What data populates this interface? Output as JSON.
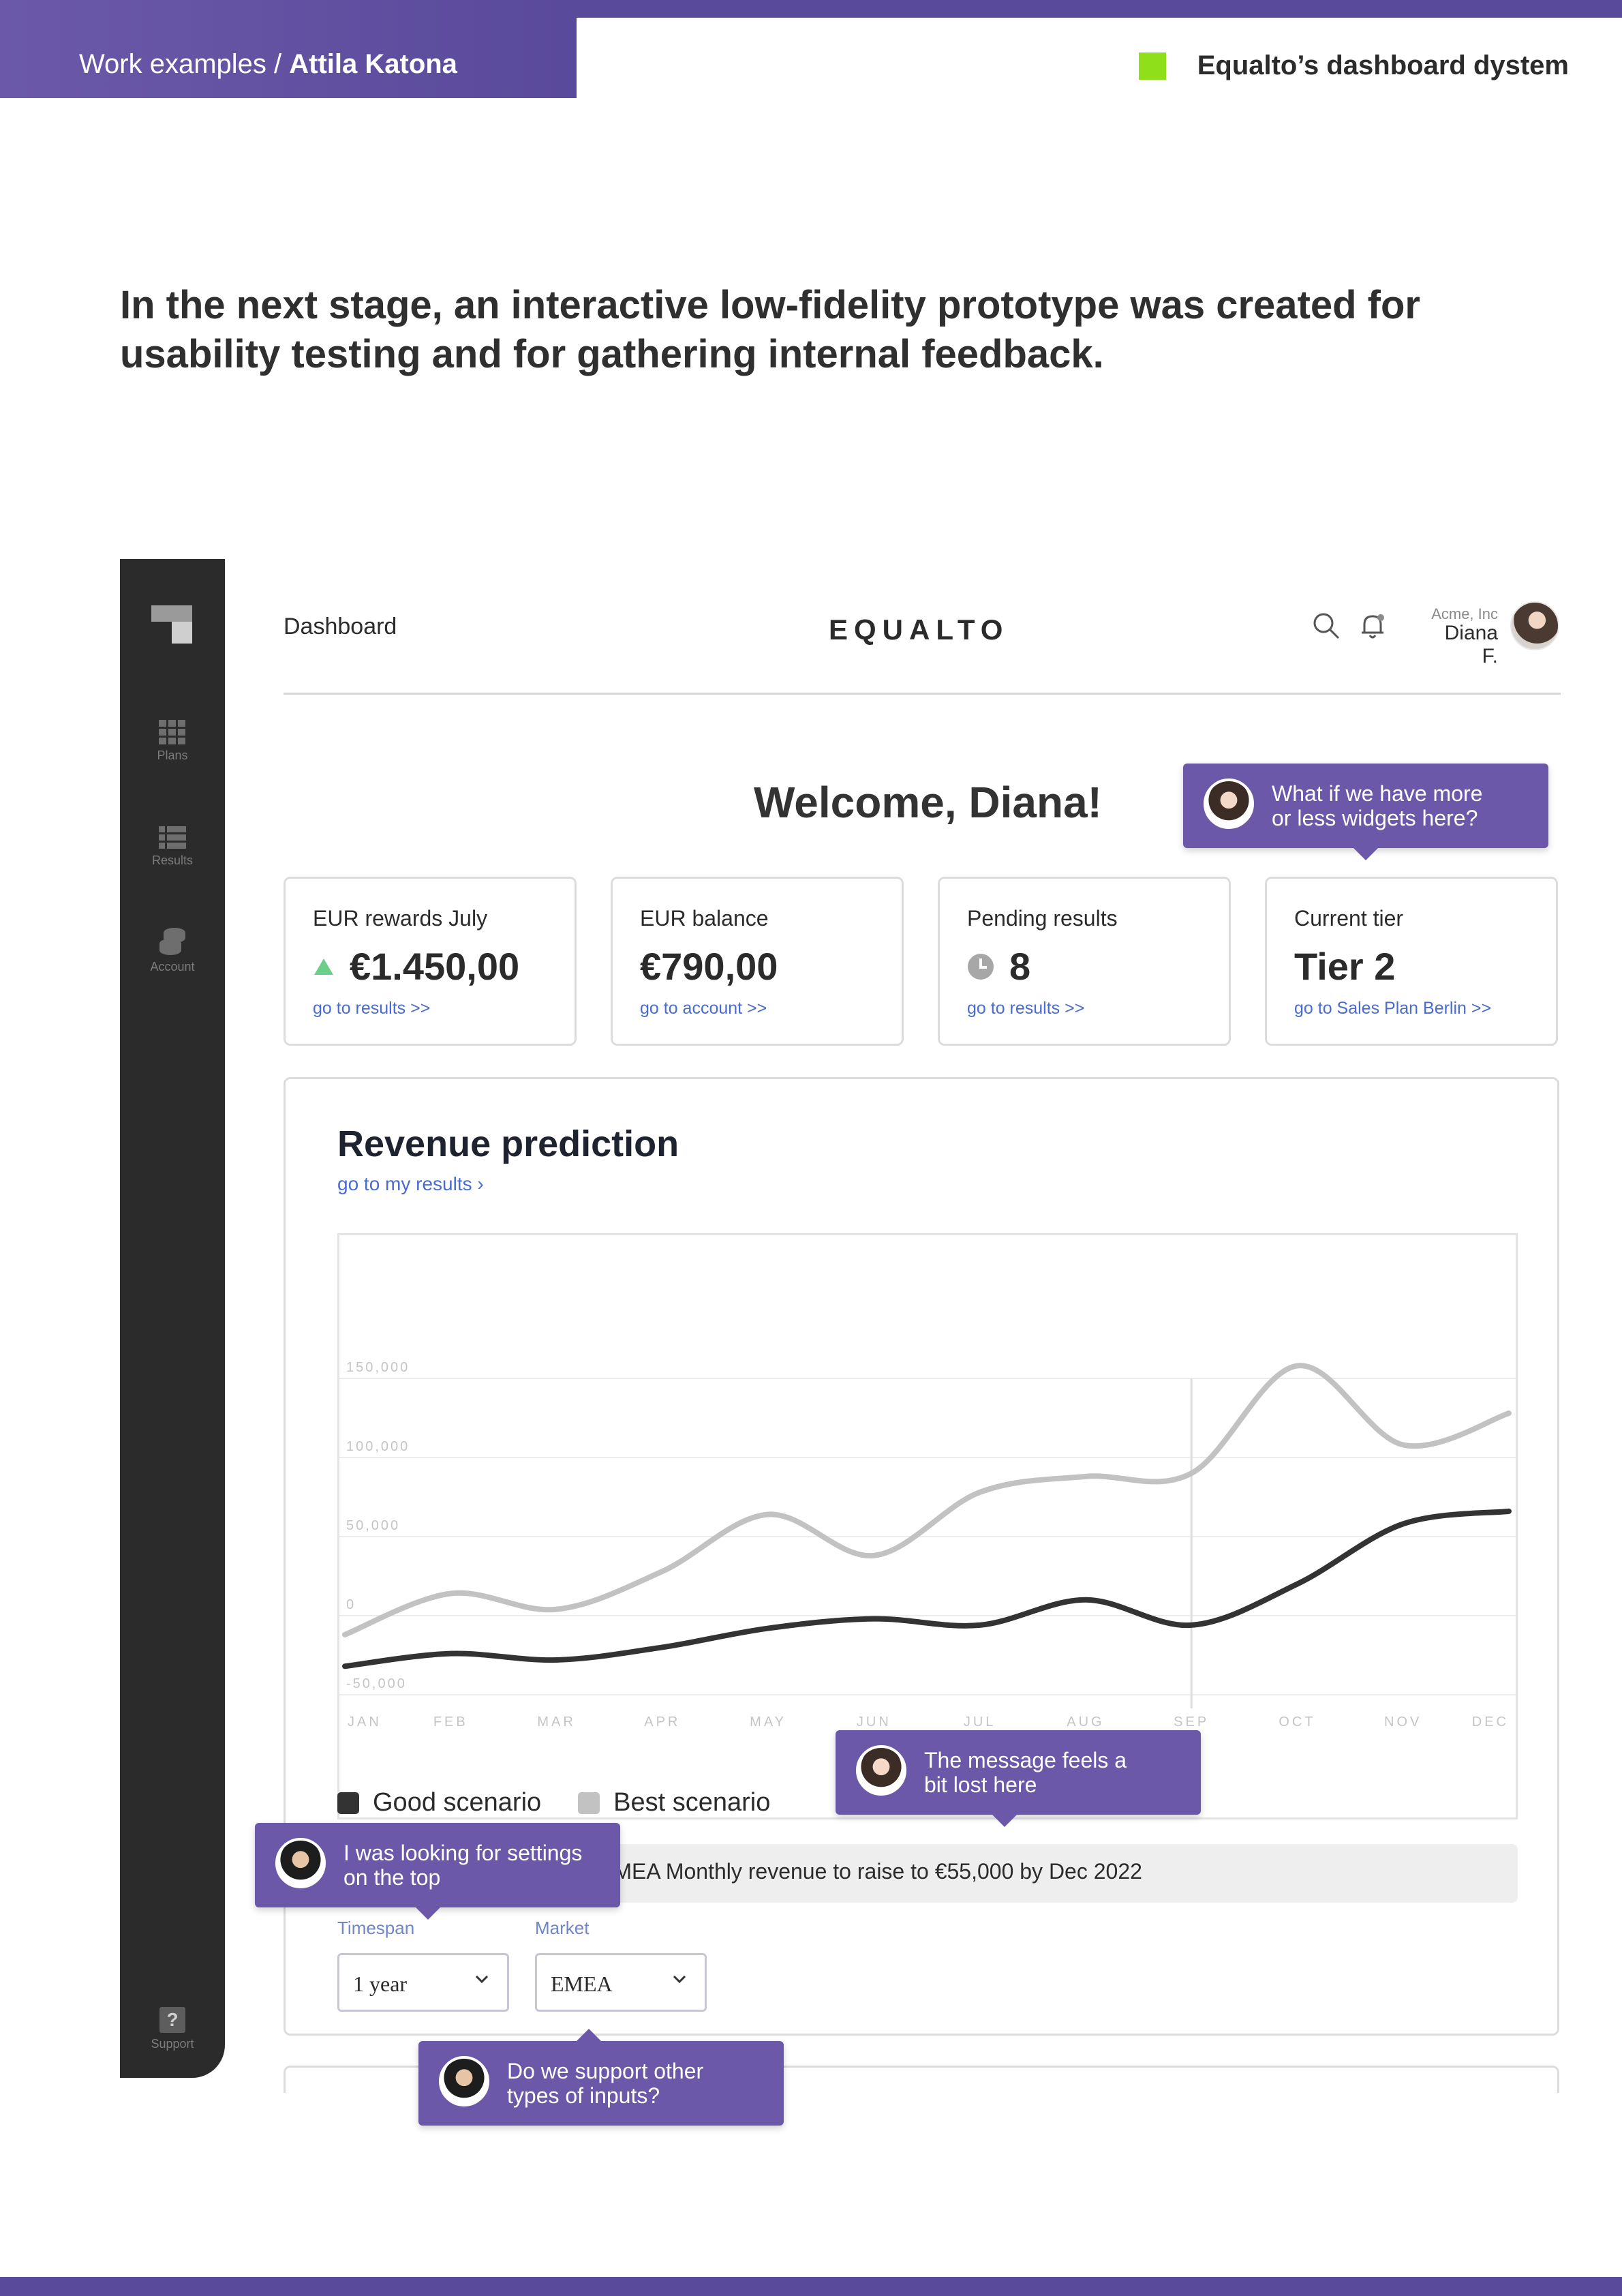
{
  "header": {
    "breadcrumb_prefix": "Work examples / ",
    "breadcrumb_author": "Attila Katona",
    "project_title": "Equalto’s dashboard dystem",
    "accent_color": "#5a4a9b",
    "marker_color": "#8fe01a"
  },
  "lead_text": "In the next stage, an interactive low-fidelity prototype was created for usability testing and for gathering internal feedback.",
  "app": {
    "sidebar": {
      "items": [
        {
          "label": "Plans",
          "icon": "grid-icon"
        },
        {
          "label": "Results",
          "icon": "list-icon"
        },
        {
          "label": "Account",
          "icon": "coins-icon"
        }
      ],
      "support_label": "Support",
      "support_glyph": "?"
    },
    "topnav": {
      "title": "Dashboard",
      "brand": "EQUALTO",
      "org": "Acme, Inc",
      "user_name": "Diana F."
    },
    "welcome": "Welcome, Diana!",
    "kpis": [
      {
        "label": "EUR rewards July",
        "value": "€1.450,00",
        "link": "go to results >>",
        "indicator": "up-triangle-icon"
      },
      {
        "label": "EUR balance",
        "value": "€790,00",
        "link": "go to account >>"
      },
      {
        "label": "Pending results",
        "value": "8",
        "link": "go to results >>",
        "indicator": "clock-icon"
      },
      {
        "label": "Current tier",
        "value": "Tier 2",
        "link": "go to Sales Plan Berlin >>"
      }
    ],
    "revenue": {
      "title": "Revenue prediction",
      "link": "go to my results",
      "link_glyph": "›",
      "banner": "EMEA Monthly revenue to raise to €55,000 by Dec 2022",
      "timespan_label": "Timespan",
      "timespan_value": "1 year",
      "market_label": "Market",
      "market_value": "EMEA"
    }
  },
  "comments": [
    {
      "author": "female",
      "text_line1": "What if we have more",
      "text_line2": "or less widgets here?"
    },
    {
      "author": "female",
      "text_line1": "The message feels a",
      "text_line2": "bit lost here"
    },
    {
      "author": "male",
      "text_line1": "I was looking for settings",
      "text_line2": "on the top"
    },
    {
      "author": "male",
      "text_line1": "Do we support other",
      "text_line2": "types of inputs?"
    }
  ],
  "chart_data": {
    "type": "line",
    "categories": [
      "JAN",
      "FEB",
      "MAR",
      "APR",
      "MAY",
      "JUN",
      "JUL",
      "AUG",
      "SEP",
      "OCT",
      "NOV",
      "DEC"
    ],
    "y_ticks": [
      "150,000",
      "100,000",
      "50,000",
      "0",
      "-50,000"
    ],
    "ylim": [
      -50000,
      150000
    ],
    "grid": true,
    "legend_position": "bottom-left",
    "series": [
      {
        "name": "Good scenario",
        "color": "#333333",
        "values": [
          -32000,
          -24000,
          -28000,
          -20000,
          -8000,
          -2000,
          -6000,
          10000,
          -6000,
          20000,
          58000,
          66000
        ]
      },
      {
        "name": "Best scenario",
        "color": "#c2c2c2",
        "values": [
          -12000,
          14000,
          4000,
          28000,
          64000,
          38000,
          78000,
          88000,
          90000,
          158000,
          108000,
          128000
        ]
      }
    ]
  }
}
